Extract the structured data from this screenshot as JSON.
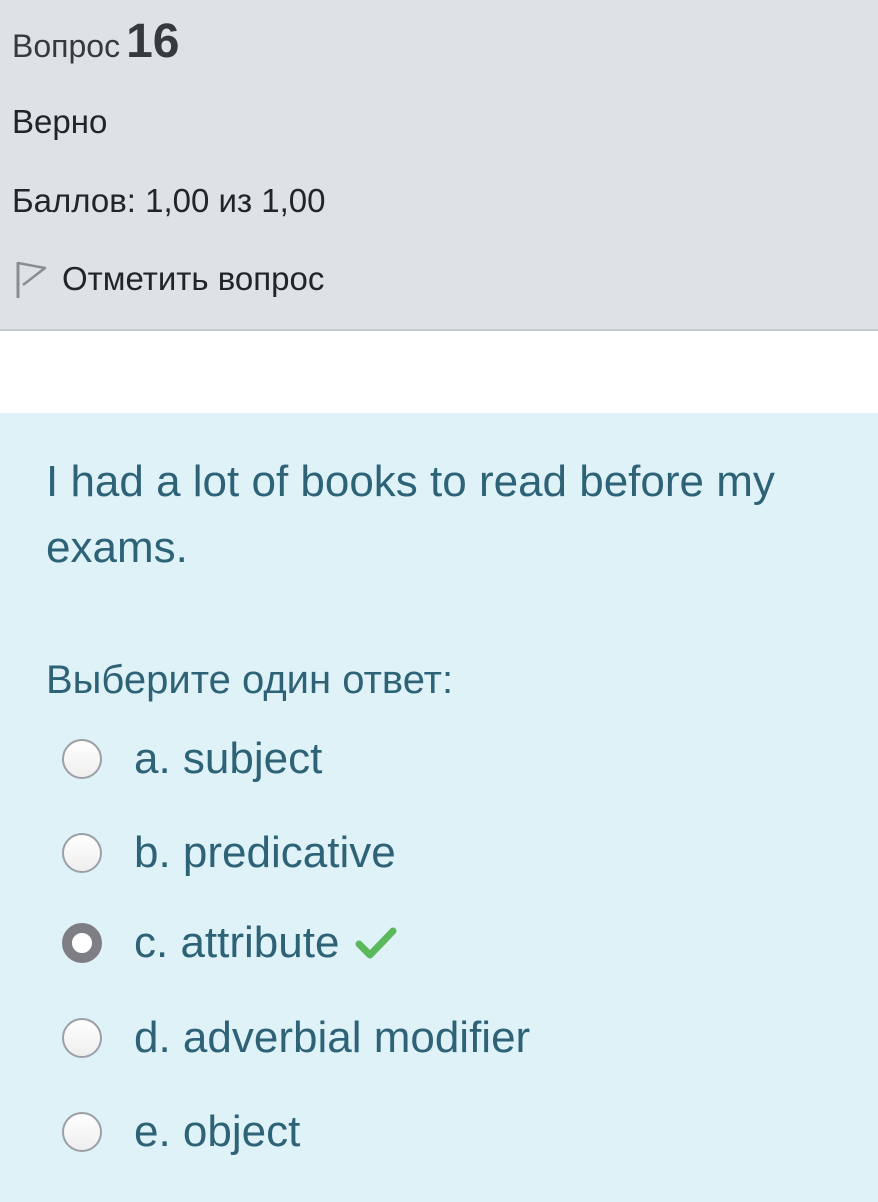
{
  "question_info": {
    "word": "Вопрос",
    "number": "16",
    "state": "Верно",
    "grade": "Баллов: 1,00 из 1,00",
    "flag_label": "Отметить вопрос",
    "flag_icon": "flag-outline-icon"
  },
  "question": {
    "text": "I had a lot of books to read before my exams.",
    "prompt": "Выберите один ответ:",
    "answers": [
      {
        "label": "a. subject",
        "selected": false
      },
      {
        "label": "b. predicative",
        "selected": false
      },
      {
        "label": "c. attribute",
        "selected": true,
        "correct": true
      },
      {
        "label": "d. adverbial modifier",
        "selected": false
      },
      {
        "label": "e. object",
        "selected": false
      }
    ],
    "correct_icon": "check-icon"
  },
  "colors": {
    "info_background": "#dee2e6",
    "content_background": "#def2f8",
    "question_text": "#2e6377",
    "correct_check": "#5cb85c"
  }
}
